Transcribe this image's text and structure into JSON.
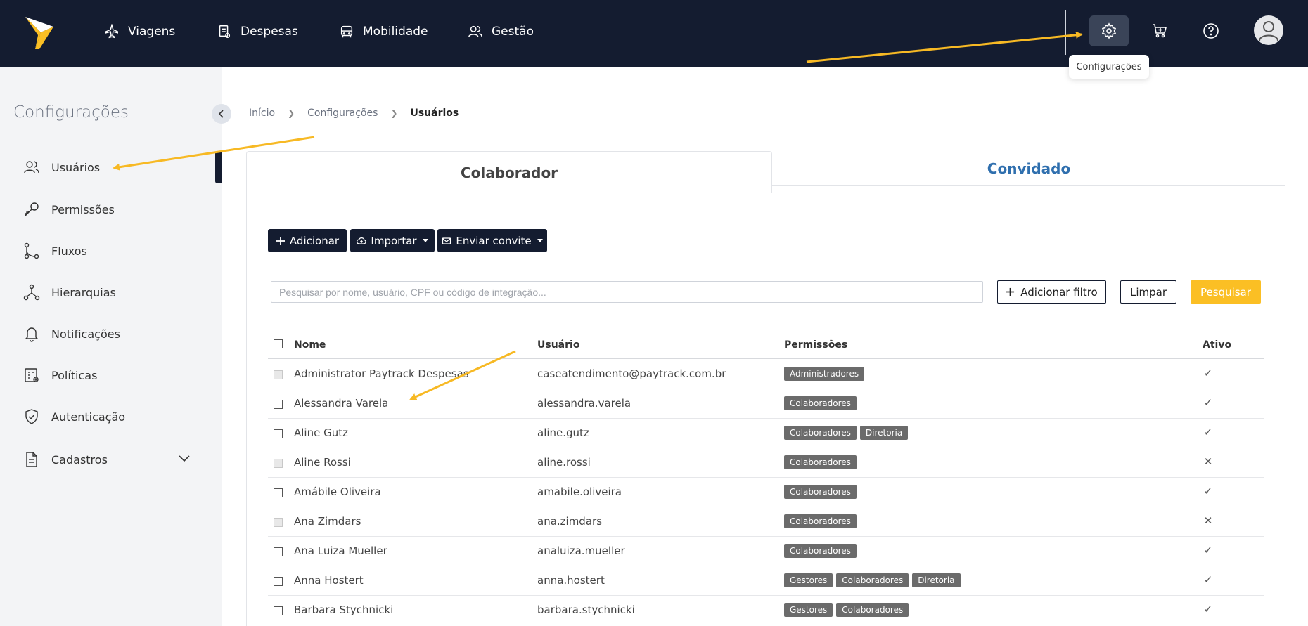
{
  "topnav": {
    "items": [
      {
        "label": "Viagens",
        "icon": "airplane-icon"
      },
      {
        "label": "Despesas",
        "icon": "receipt-icon"
      },
      {
        "label": "Mobilidade",
        "icon": "car-icon"
      },
      {
        "label": "Gestão",
        "icon": "users-icon"
      }
    ],
    "right_icons": [
      "gear-icon",
      "cart-icon",
      "help-icon",
      "user-avatar-icon"
    ],
    "tooltip": "Configurações"
  },
  "sidebar": {
    "title": "Configurações",
    "items": [
      {
        "label": "Usuários",
        "icon": "users-icon"
      },
      {
        "label": "Permissões",
        "icon": "key-icon"
      },
      {
        "label": "Fluxos",
        "icon": "flow-icon"
      },
      {
        "label": "Hierarquias",
        "icon": "hierarchy-icon"
      },
      {
        "label": "Notificações",
        "icon": "bell-icon"
      },
      {
        "label": "Políticas",
        "icon": "policy-icon"
      },
      {
        "label": "Autenticação",
        "icon": "shield-icon"
      },
      {
        "label": "Cadastros",
        "icon": "document-icon"
      }
    ]
  },
  "breadcrumb": [
    "Início",
    "Configurações",
    "Usuários"
  ],
  "tabs": [
    "Colaborador",
    "Convidado"
  ],
  "actions": {
    "add": "Adicionar",
    "import": "Importar",
    "invite": "Enviar convite"
  },
  "search": {
    "placeholder": "Pesquisar por nome, usuário, CPF ou código de integração...",
    "add_filter": "Adicionar filtro",
    "clear": "Limpar",
    "search": "Pesquisar"
  },
  "table": {
    "columns": [
      "Nome",
      "Usuário",
      "Permissões",
      "Ativo"
    ],
    "rows": [
      {
        "name": "Administrator Paytrack Despesas",
        "user": "caseatendimento@paytrack.com.br",
        "permissions": [
          "Administradores"
        ],
        "active": true,
        "checkbox_disabled": true
      },
      {
        "name": "Alessandra Varela",
        "user": "alessandra.varela",
        "permissions": [
          "Colaboradores"
        ],
        "active": true,
        "checkbox_disabled": false
      },
      {
        "name": "Aline Gutz",
        "user": "aline.gutz",
        "permissions": [
          "Colaboradores",
          "Diretoria"
        ],
        "active": true,
        "checkbox_disabled": false
      },
      {
        "name": "Aline Rossi",
        "user": "aline.rossi",
        "permissions": [
          "Colaboradores"
        ],
        "active": false,
        "checkbox_disabled": true
      },
      {
        "name": "Amábile Oliveira",
        "user": "amabile.oliveira",
        "permissions": [
          "Colaboradores"
        ],
        "active": true,
        "checkbox_disabled": false
      },
      {
        "name": "Ana Zimdars",
        "user": "ana.zimdars",
        "permissions": [
          "Colaboradores"
        ],
        "active": false,
        "checkbox_disabled": true
      },
      {
        "name": "Ana Luiza Mueller",
        "user": "analuiza.mueller",
        "permissions": [
          "Colaboradores"
        ],
        "active": true,
        "checkbox_disabled": false
      },
      {
        "name": "Anna Hostert",
        "user": "anna.hostert",
        "permissions": [
          "Gestores",
          "Colaboradores",
          "Diretoria"
        ],
        "active": true,
        "checkbox_disabled": false
      },
      {
        "name": "Barbara Stychnicki",
        "user": "barbara.stychnicki",
        "permissions": [
          "Gestores",
          "Colaboradores"
        ],
        "active": true,
        "checkbox_disabled": false
      }
    ]
  },
  "colors": {
    "navbar": "#141c30",
    "accent_yellow": "#fbbf24",
    "link_blue": "#2f6fae",
    "tag_gray": "#6b6b6b",
    "annotation_arrow": "#f7b924"
  }
}
